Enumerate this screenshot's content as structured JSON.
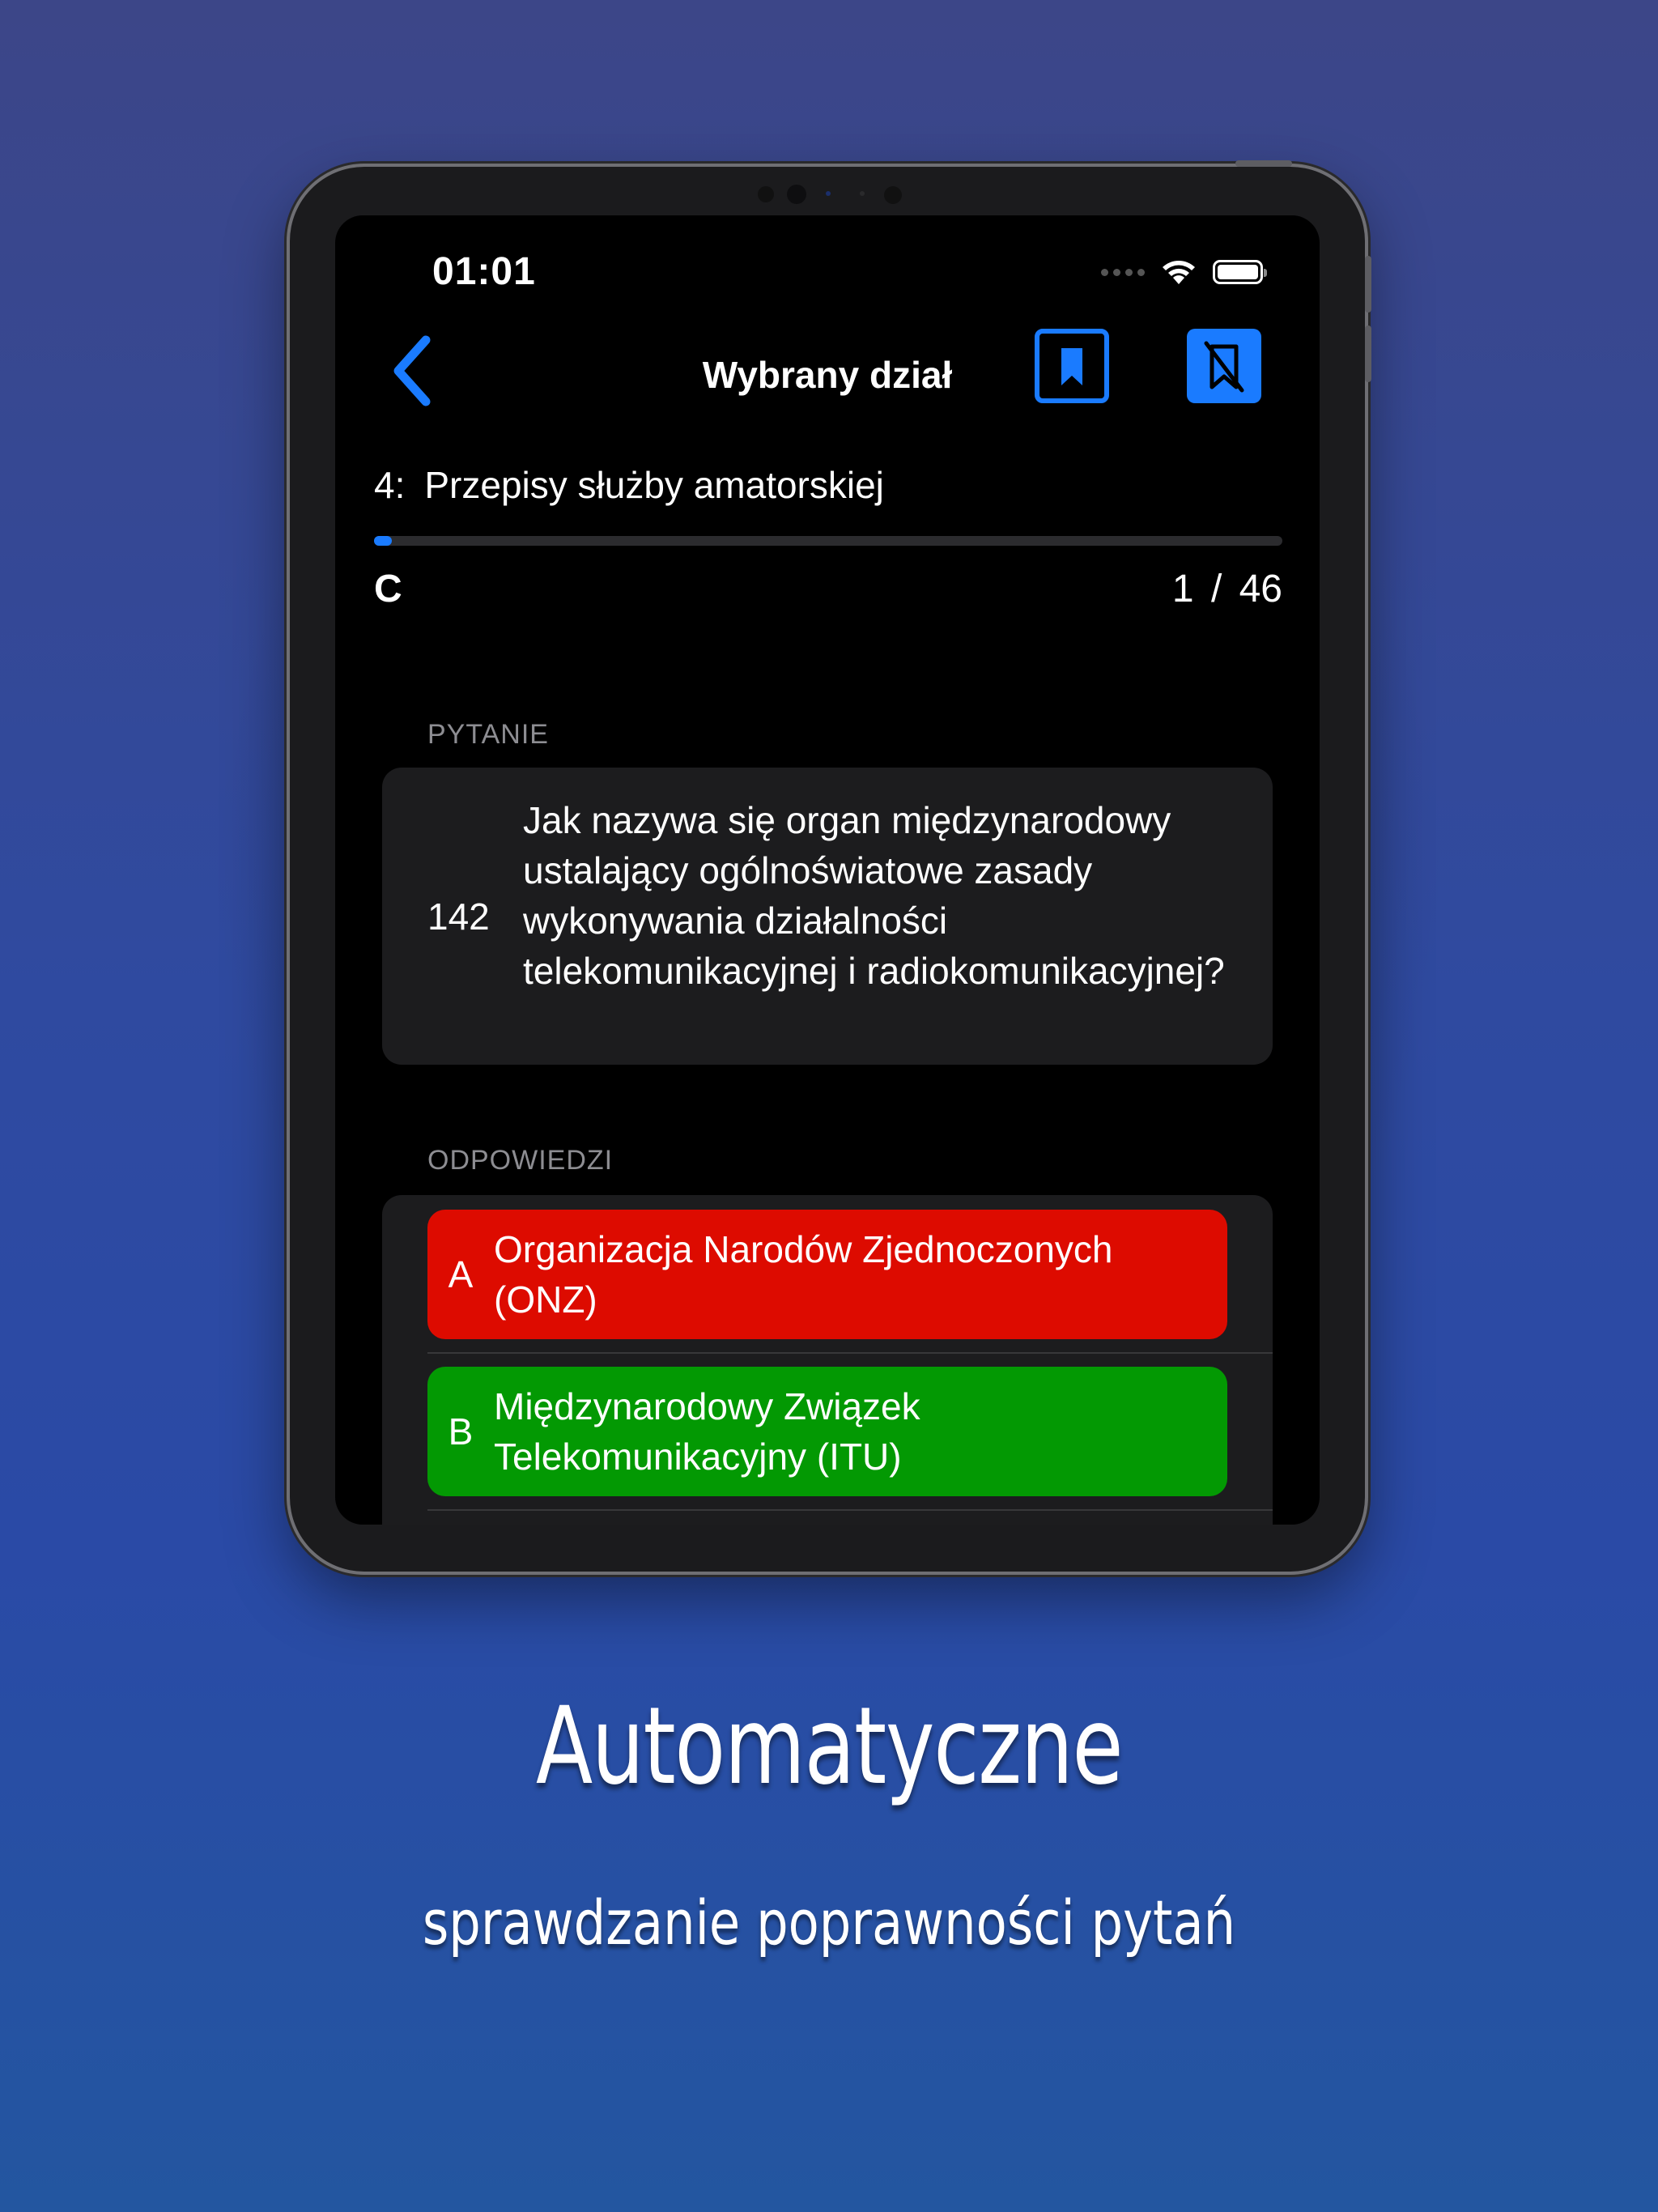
{
  "status_bar": {
    "time": "01:01"
  },
  "nav": {
    "title": "Wybrany dział",
    "back_icon": "chevron-left-icon",
    "bookmark_icon": "bookmark-icon",
    "bookmark_off_icon": "bookmark-slash-icon"
  },
  "section": {
    "number": "4:",
    "name": "Przepisy służby amatorskiej",
    "progress": 0.02
  },
  "grade": "C",
  "counter": "1 / 46",
  "question": {
    "label": "PYTANIE",
    "number": "142",
    "text": "Jak nazywa się organ międzynarodowy ustalający ogólnoświatowe zasady wykonywania działalności telekomunikacyjnej i radiokomunikacyjnej?"
  },
  "answers": {
    "label": "ODPOWIEDZI",
    "items": [
      {
        "letter": "A",
        "text": "Organizacja Narodów Zjednoczonych (ONZ)",
        "state": "incorrect",
        "color": "#dd0b00"
      },
      {
        "letter": "B",
        "text": "Międzynarodowy Związek Telekomunikacyjny (ITU)",
        "state": "correct",
        "color": "#039903"
      }
    ]
  },
  "promo": {
    "title": "Automatyczne",
    "subtitle": "sprawdzanie poprawności pytań"
  },
  "colors": {
    "accent": "#1a7bff",
    "card": "#1c1c1e",
    "screen": "#000000"
  }
}
